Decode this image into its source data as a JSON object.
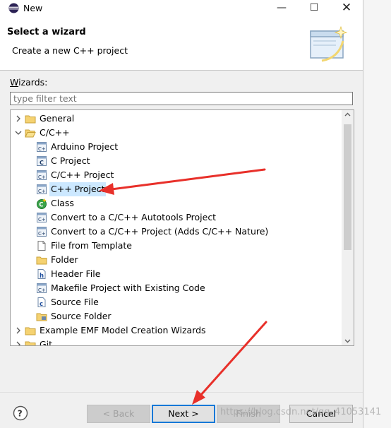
{
  "window": {
    "title": "New"
  },
  "header": {
    "title": "Select a wizard",
    "description": "Create a new C++ project"
  },
  "wizards": {
    "label_mnemonic": "W",
    "label_rest": "izards:",
    "filter_placeholder": "type filter text",
    "items": [
      {
        "label": "General",
        "icon": "folder-icon",
        "expanded": false
      },
      {
        "label": "C/C++",
        "icon": "folder-icon",
        "expanded": true
      },
      {
        "label": "Arduino Project",
        "icon": "cpp-project-icon"
      },
      {
        "label": "C Project",
        "icon": "c-project-icon"
      },
      {
        "label": "C/C++ Project",
        "icon": "cpp-project-icon"
      },
      {
        "label": "C++ Project",
        "icon": "cpp-project-icon",
        "selected": true
      },
      {
        "label": "Class",
        "icon": "class-icon"
      },
      {
        "label": "Convert to a C/C++ Autotools Project",
        "icon": "cpp-project-icon"
      },
      {
        "label": "Convert to a C/C++ Project (Adds C/C++ Nature)",
        "icon": "cpp-project-icon"
      },
      {
        "label": "File from Template",
        "icon": "file-icon"
      },
      {
        "label": "Folder",
        "icon": "folder-icon"
      },
      {
        "label": "Header File",
        "icon": "header-file-icon"
      },
      {
        "label": "Makefile Project with Existing Code",
        "icon": "cpp-project-icon"
      },
      {
        "label": "Source File",
        "icon": "source-file-icon"
      },
      {
        "label": "Source Folder",
        "icon": "source-folder-icon"
      },
      {
        "label": "Example EMF Model Creation Wizards",
        "icon": "folder-icon",
        "expanded": false
      },
      {
        "label": "Git",
        "icon": "folder-icon",
        "expanded": false
      }
    ]
  },
  "buttons": {
    "back": "< Back",
    "next": "Next >",
    "finish": "Finish",
    "cancel": "Cancel"
  },
  "watermark": "https://blog.csdn.net/qq_41053141",
  "colors": {
    "selection": "#cce8ff",
    "default_button_border": "#0078d7",
    "annotation_arrow": "#e8302a"
  }
}
